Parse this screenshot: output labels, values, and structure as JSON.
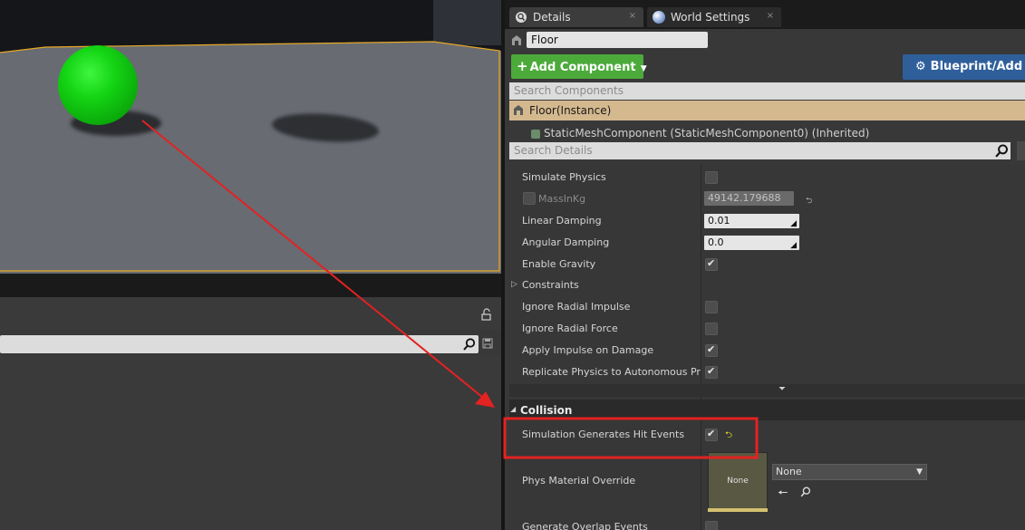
{
  "colors": {
    "ball": "#16d416",
    "floor": "#686b72",
    "selection_outline": "#e6a825",
    "add_component_button": "#4caa3b",
    "blueprint_button": "#2f5f9b",
    "component_root_highlight": "#d4b88e",
    "annotation": "#e32222"
  },
  "tabs": [
    {
      "label": "Details",
      "icon": "magnifier-icon"
    },
    {
      "label": "World Settings",
      "icon": "globe-icon"
    }
  ],
  "tab_close_glyph": "×",
  "actor_name": "Floor",
  "add_component_label": "Add Component",
  "blueprint_label": "Blueprint/Add S",
  "search_components_placeholder": "Search Components",
  "components": {
    "root": "Floor(Instance)",
    "child": "StaticMeshComponent (StaticMeshComponent0) (Inherited)"
  },
  "search_details_placeholder": "Search Details",
  "physics": {
    "simulate_physics": {
      "label": "Simulate Physics",
      "checked": false
    },
    "mass": {
      "label": "MassInKg",
      "value": "49142.179688",
      "enabled": false
    },
    "linear_damping": {
      "label": "Linear Damping",
      "value": "0.01"
    },
    "angular_damping": {
      "label": "Angular Damping",
      "value": "0.0"
    },
    "enable_gravity": {
      "label": "Enable Gravity",
      "checked": true
    },
    "constraints": {
      "label": "Constraints"
    },
    "ignore_radial_impulse": {
      "label": "Ignore Radial Impulse",
      "checked": false
    },
    "ignore_radial_force": {
      "label": "Ignore Radial Force",
      "checked": false
    },
    "apply_impulse_on_damage": {
      "label": "Apply Impulse on Damage",
      "checked": true
    },
    "replicate_physics": {
      "label": "Replicate Physics to Autonomous Proxy",
      "checked": true
    }
  },
  "collision": {
    "header": "Collision",
    "sim_hit_events": {
      "label": "Simulation Generates Hit Events",
      "checked": true
    },
    "phys_material_override": {
      "label": "Phys Material Override",
      "thumbnail": "None",
      "value": "None"
    },
    "generate_overlap_events": {
      "label": "Generate Overlap Events",
      "checked": false
    }
  }
}
